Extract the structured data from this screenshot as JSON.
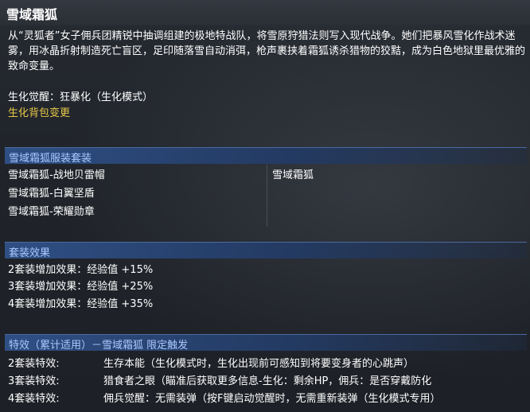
{
  "title": "雪域霜狐",
  "description": "从“灵狐者”女子佣兵团精锐中抽调组建的极地特战队，将雪原狩猎法则写入现代战争。她们把暴风雪化作战术迷雾，用冰晶折射制造死亡盲区，足印随落雪自动消弭，枪声裹挟着霜狐诱杀猎物的狡黠，成为白色地狱里最优雅的致命变量。",
  "awaken": "生化觉醒：狂暴化（生化模式）",
  "bag_change": "生化背包变更",
  "set_section": {
    "header": "雪域霜狐服装套装",
    "left_items": [
      "雪域霜狐-战地贝雷帽",
      "雪域霜狐-白翼坚盾",
      "雪域霜狐-荣耀勋章"
    ],
    "right_items": [
      "雪域霜狐"
    ]
  },
  "effect_section": {
    "header": "套装效果",
    "rows": [
      "2套装增加效果：经验值 +15%",
      "3套装增加效果：经验值 +25%",
      "4套装增加效果：经验值 +35%"
    ]
  },
  "special_section": {
    "header": "特效（累计适用）－雪域霜狐 限定触发",
    "rows": [
      {
        "label": "2套装特效:",
        "value": "生存本能（生化模式时，生化出现前可感知到将要变身者的心跳声）"
      },
      {
        "label": "3套装特效:",
        "value": "猎食者之眼（瞄准后获取更多信息-生化：剩余HP，佣兵：是否穿戴防化"
      },
      {
        "label": "4套装特效:",
        "value": "佣兵觉醒：无需装弹（按F键启动觉醒时，无需重新装弹（生化模式专用）"
      }
    ]
  },
  "colors": {
    "accent_gold": "#e8c84a",
    "header_blue": "#2f4f84",
    "header_text": "#a9c8ff"
  }
}
